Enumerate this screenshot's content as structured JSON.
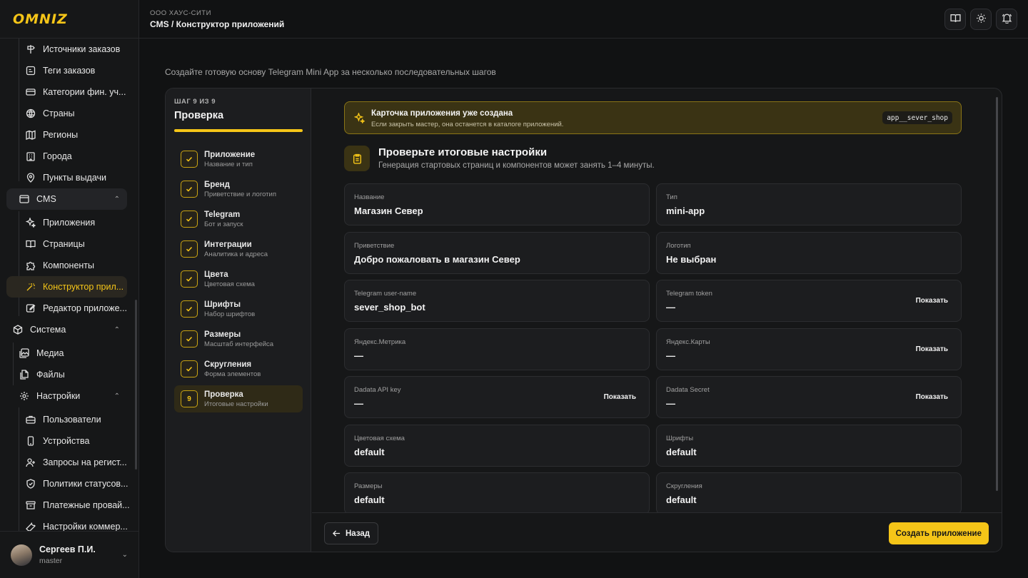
{
  "brand": {
    "logo": "OMNIZ",
    "accent": "#f5c518"
  },
  "header": {
    "org": "ООО ХАУС-СИТИ",
    "breadcrumb": "CMS / Конструктор приложений",
    "buttons": [
      {
        "icon": "book-icon"
      },
      {
        "icon": "sun-icon"
      },
      {
        "icon": "bell-icon"
      }
    ]
  },
  "sidebar": {
    "items": [
      {
        "label": "Источники заказов",
        "icon": "signpost-icon"
      },
      {
        "label": "Теги заказов",
        "icon": "tag-icon"
      },
      {
        "label": "Категории фин. уч...",
        "icon": "card-icon"
      },
      {
        "label": "Страны",
        "icon": "globe-icon"
      },
      {
        "label": "Регионы",
        "icon": "map-icon"
      },
      {
        "label": "Города",
        "icon": "building-icon"
      },
      {
        "label": "Пункты выдачи",
        "icon": "pin-icon"
      }
    ],
    "cms": {
      "label": "CMS",
      "icon": "window-icon"
    },
    "cms_items": [
      {
        "label": "Приложения",
        "icon": "sparkle-icon"
      },
      {
        "label": "Страницы",
        "icon": "book-icon"
      },
      {
        "label": "Компоненты",
        "icon": "puzzle-icon"
      },
      {
        "label": "Конструктор прил...",
        "icon": "wand-icon",
        "active": true
      },
      {
        "label": "Редактор приложе...",
        "icon": "edit-icon"
      }
    ],
    "system": {
      "label": "Система",
      "icon": "box-icon"
    },
    "system_items": [
      {
        "label": "Медиа",
        "icon": "images-icon"
      },
      {
        "label": "Файлы",
        "icon": "files-icon"
      }
    ],
    "settings": {
      "label": "Настройки",
      "icon": "gear-icon"
    },
    "settings_items": [
      {
        "label": "Пользователи",
        "icon": "briefcase-icon"
      },
      {
        "label": "Устройства",
        "icon": "phone-icon"
      },
      {
        "label": "Запросы на регист...",
        "icon": "user-plus-icon"
      },
      {
        "label": "Политики статусов...",
        "icon": "shield-icon"
      },
      {
        "label": "Платежные провай...",
        "icon": "archive-icon"
      },
      {
        "label": "Настройки коммер...",
        "icon": "wrench-icon"
      }
    ],
    "user": {
      "name": "Сергеев П.И.",
      "role": "master"
    }
  },
  "page": {
    "subtitle": "Создайте готовую основу Telegram Mini App за несколько последовательных шагов"
  },
  "wizard": {
    "step_count": "ШАГ 9 ИЗ 9",
    "step_title": "Проверка",
    "progress": 1.0,
    "steps": [
      {
        "name": "Приложение",
        "desc": "Название и тип",
        "done": true
      },
      {
        "name": "Бренд",
        "desc": "Приветствие и логотип",
        "done": true
      },
      {
        "name": "Telegram",
        "desc": "Бот и запуск",
        "done": true
      },
      {
        "name": "Интеграции",
        "desc": "Аналитика и адреса",
        "done": true
      },
      {
        "name": "Цвета",
        "desc": "Цветовая схема",
        "done": true
      },
      {
        "name": "Шрифты",
        "desc": "Набор шрифтов",
        "done": true
      },
      {
        "name": "Размеры",
        "desc": "Масштаб интерфейса",
        "done": true
      },
      {
        "name": "Скругления",
        "desc": "Форма элементов",
        "done": true
      },
      {
        "name": "Проверка",
        "desc": "Итоговые настройки",
        "number": "9",
        "current": true
      }
    ],
    "notice": {
      "title": "Карточка приложения уже создана",
      "desc": "Если закрыть мастер, она останется в каталоге приложений.",
      "chip": "app__sever_shop"
    },
    "review": {
      "title": "Проверьте итоговые настройки",
      "desc": "Генерация стартовых страниц и компонентов может занять 1–4 минуты."
    },
    "fields": [
      {
        "label": "Название",
        "value": "Магазин Север"
      },
      {
        "label": "Тип",
        "value": "mini-app"
      },
      {
        "label": "Приветствие",
        "value": "Добро пожаловать в магазин Север"
      },
      {
        "label": "Логотип",
        "value": "Не выбран"
      },
      {
        "label": "Telegram user-name",
        "value": "sever_shop_bot"
      },
      {
        "label": "Telegram token",
        "value": "—",
        "action": "Показать"
      },
      {
        "label": "Яндекс.Метрика",
        "value": "—"
      },
      {
        "label": "Яндекс.Карты",
        "value": "—",
        "action": "Показать"
      },
      {
        "label": "Dadata API key",
        "value": "—",
        "action": "Показать"
      },
      {
        "label": "Dadata Secret",
        "value": "—",
        "action": "Показать"
      },
      {
        "label": "Цветовая схема",
        "value": "default"
      },
      {
        "label": "Шрифты",
        "value": "default"
      },
      {
        "label": "Размеры",
        "value": "default"
      },
      {
        "label": "Скругления",
        "value": "default"
      }
    ],
    "back_label": "Назад",
    "create_label": "Создать приложение"
  }
}
